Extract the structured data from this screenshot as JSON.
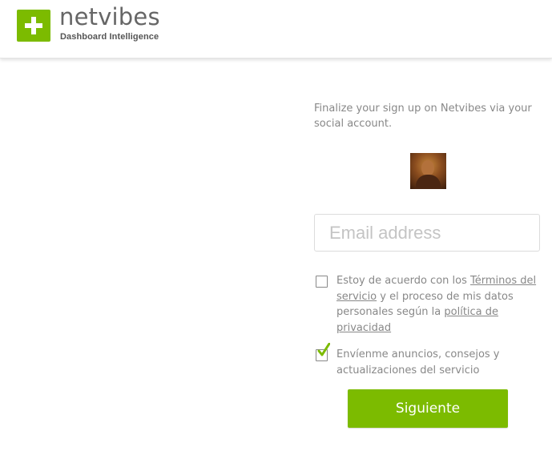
{
  "header": {
    "brand_name": "netvibes",
    "tagline": "Dashboard Intelligence",
    "brand_color": "#7cbb00"
  },
  "signup": {
    "intro": "Finalize your sign up on Netvibes via your social account.",
    "avatar_icon": "user-avatar",
    "email_placeholder": "Email address",
    "email_value": "",
    "terms": {
      "checked": false,
      "text_before": "Estoy de acuerdo con los ",
      "terms_link": "Términos del servicio",
      "text_middle": " y el proceso de mis datos personales según la ",
      "privacy_link": "política de privacidad"
    },
    "newsletter": {
      "checked": true,
      "text": "Envíenme anuncios, consejos y actualizaciones del servicio"
    },
    "next_button": "Siguiente"
  }
}
